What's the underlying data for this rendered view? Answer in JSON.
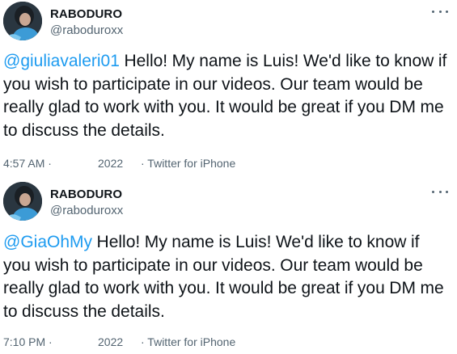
{
  "tweets": [
    {
      "author_name": "RABODURO",
      "author_handle": "@raboduroxx",
      "mention": "@giuliavaleri01",
      "body": " Hello! My name is Luis! We'd like to know if you wish to participate in our videos. Our team would be really glad to work with you. It would be great if you DM me to discuss the details.",
      "time": "4:57 AM ·",
      "date": "2022",
      "source": "· Twitter for iPhone",
      "more_icon": "more-horizontal-icon"
    },
    {
      "author_name": "RABODURO",
      "author_handle": "@raboduroxx",
      "mention": "@GiaOhMy",
      "body": " Hello! My name is Luis! We'd like to know if you wish to participate in our videos. Our team would be really glad to work with you. It would be great if you DM me to discuss the details.",
      "time": "7:10 PM ·",
      "date": "2022",
      "source": "· Twitter for iPhone",
      "more_icon": "more-horizontal-icon"
    }
  ],
  "colors": {
    "text": "#0f1419",
    "secondary": "#536471",
    "link": "#1d9bf0",
    "background": "#ffffff"
  }
}
